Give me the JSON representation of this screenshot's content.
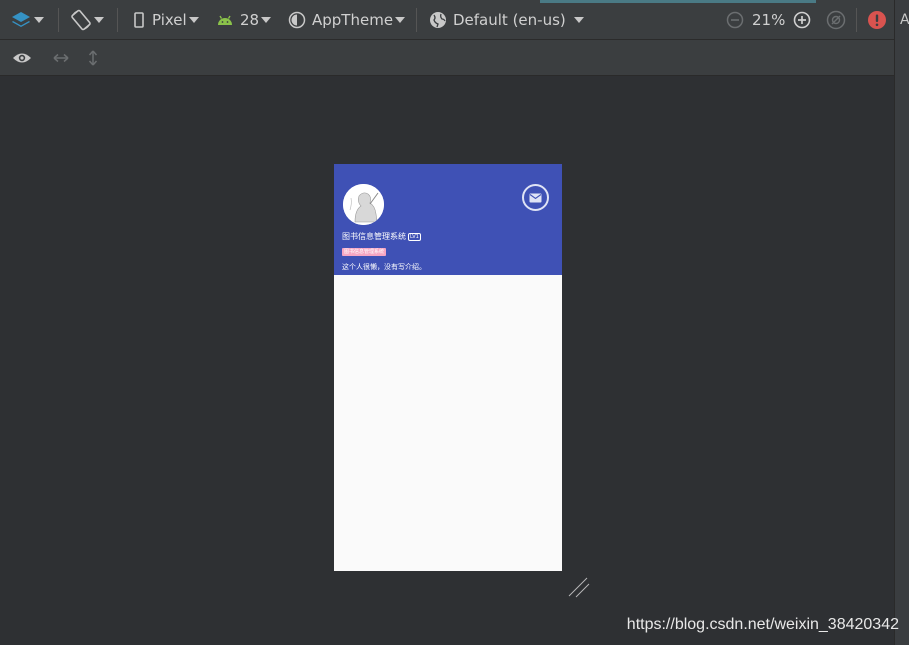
{
  "toolbar": {
    "device": "Pixel",
    "api_level": "28",
    "theme": "AppTheme",
    "locale": "Default (en-us)",
    "zoom": "21%",
    "right_cut_text": "A"
  },
  "phone": {
    "app_title": "图书信息管理系统",
    "level_badge": "LV1",
    "tag": "图书信息管理系统",
    "intro": "这个人很懒，没有写介绍。"
  },
  "watermark": "https://blog.csdn.net/weixin_38420342",
  "colors": {
    "header": "#3f51b5",
    "tag": "#f7a6c3",
    "error": "#d9534f",
    "android": "#8bc34a",
    "layers": "#3592c4"
  }
}
